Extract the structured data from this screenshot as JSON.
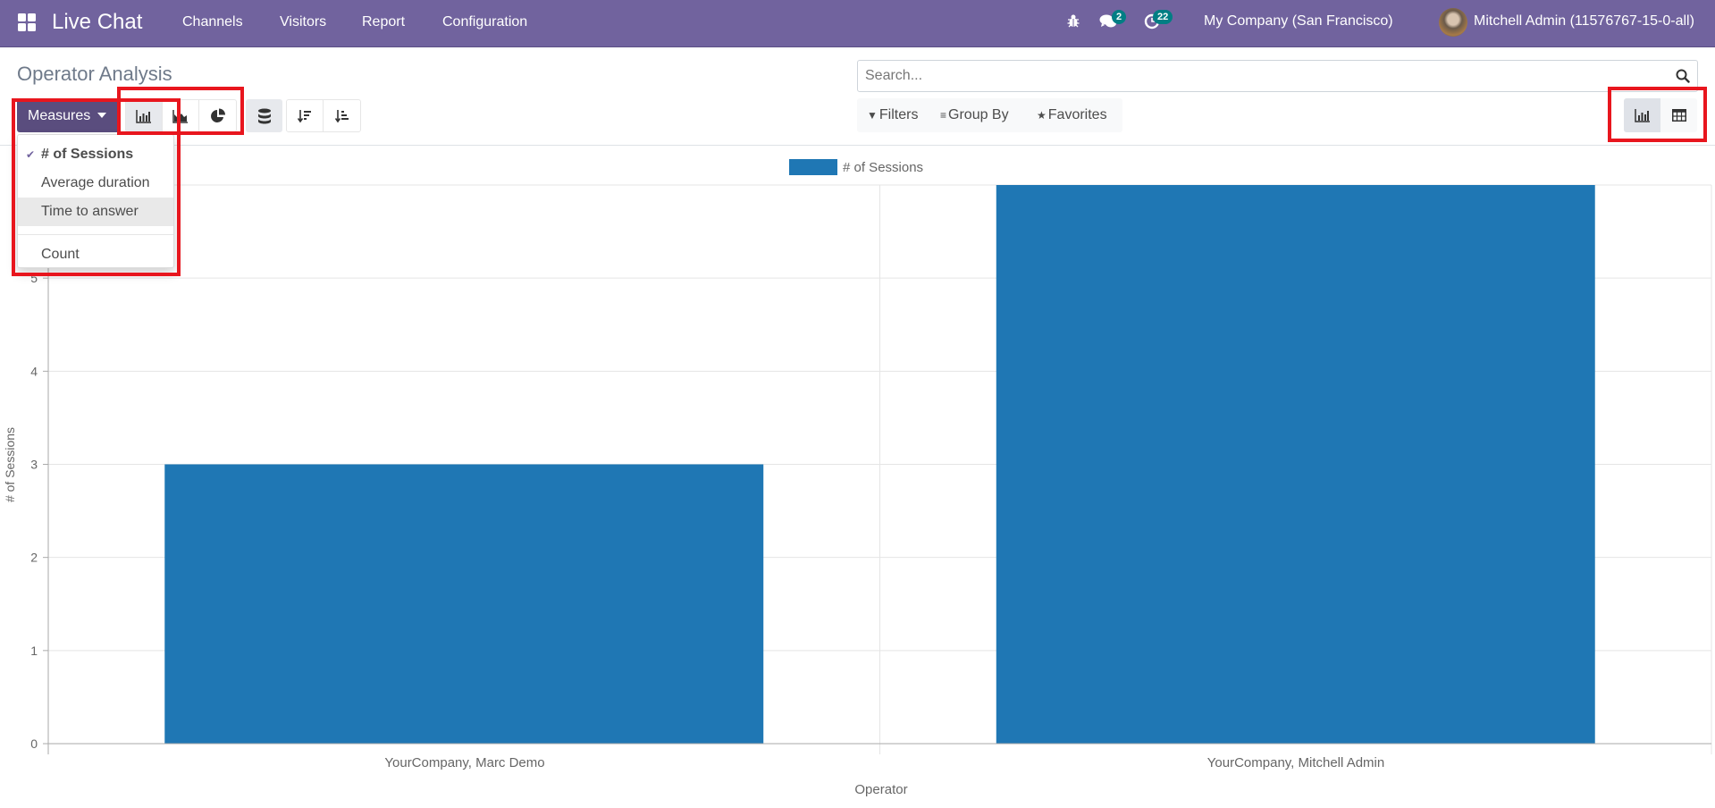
{
  "navbar": {
    "app_name": "Live Chat",
    "menus": [
      "Channels",
      "Visitors",
      "Report",
      "Configuration"
    ],
    "messages_count": "2",
    "activities_count": "22",
    "company": "My Company (San Francisco)",
    "user": "Mitchell Admin (11576767-15-0-all)",
    "color": "#71639e",
    "badge_color": "#017e84"
  },
  "page": {
    "title": "Operator Analysis"
  },
  "search": {
    "placeholder": "Search...",
    "value": ""
  },
  "facets": {
    "filters": "Filters",
    "group_by": "Group By",
    "favorites": "Favorites"
  },
  "toolbar": {
    "measures_label": "Measures",
    "chart_types": [
      "bar-chart",
      "line-chart",
      "pie-chart"
    ],
    "active_chart_type": "bar-chart",
    "stacked": true,
    "sort": [
      "descending",
      "ascending"
    ],
    "views": [
      "graph",
      "pivot"
    ],
    "active_view": "graph"
  },
  "measures_dropdown": {
    "items": [
      {
        "label": "# of Sessions",
        "selected": true
      },
      {
        "label": "Average duration",
        "selected": false
      },
      {
        "label": "Time to answer",
        "selected": false,
        "hovered": true
      },
      {
        "label": "Count",
        "selected": false
      }
    ]
  },
  "highlights": [
    "measures-dropdown",
    "chart-type-buttons",
    "view-switcher"
  ],
  "chart_data": {
    "type": "bar",
    "title": "",
    "legend": [
      "# of Sessions"
    ],
    "legend_position": "top-center",
    "categories": [
      "YourCompany, Marc Demo",
      "YourCompany, Mitchell Admin"
    ],
    "series": [
      {
        "name": "# of Sessions",
        "values": [
          3,
          6
        ],
        "color": "#1f77b4"
      }
    ],
    "xlabel": "Operator",
    "ylabel": "# of Sessions",
    "ylim": [
      0,
      6
    ],
    "yticks": [
      0,
      1,
      2,
      3,
      4,
      5,
      6
    ],
    "grid": true
  }
}
